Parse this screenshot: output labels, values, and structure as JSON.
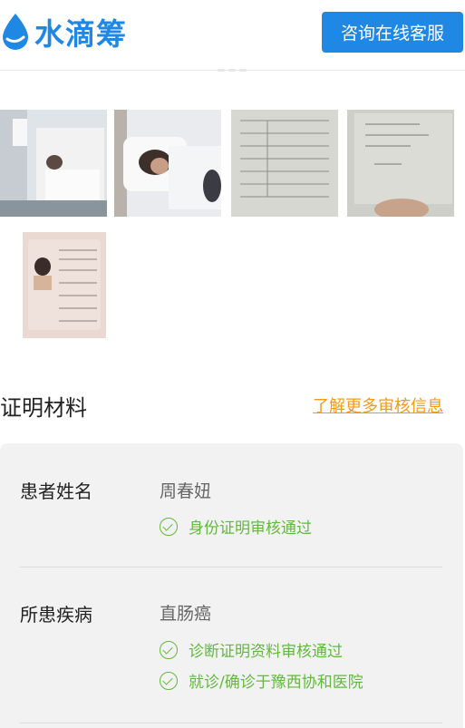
{
  "header": {
    "logo_text": "水滴筹",
    "consult_button": "咨询在线客服"
  },
  "photos": [
    {
      "name": "hospital-bed-photo",
      "kind": "photo"
    },
    {
      "name": "patient-in-bed-photo",
      "kind": "photo"
    },
    {
      "name": "medical-document-photo",
      "kind": "photo"
    },
    {
      "name": "medical-record-photo",
      "kind": "photo"
    },
    {
      "name": "id-card-photo",
      "kind": "photo"
    }
  ],
  "proof": {
    "section_title": "证明材料",
    "more_link": "了解更多审核信息",
    "rows": [
      {
        "label": "患者姓名",
        "value": "周春妞",
        "checks": [
          "身份证明审核通过"
        ]
      },
      {
        "label": "所患疾病",
        "value": "直肠癌",
        "checks": [
          "诊断证明资料审核通过",
          "就诊/确诊于豫西协和医院"
        ]
      }
    ]
  },
  "colors": {
    "brand_blue": "#1f88e5",
    "link_orange": "#f39a1b",
    "check_green": "#62b83f"
  }
}
